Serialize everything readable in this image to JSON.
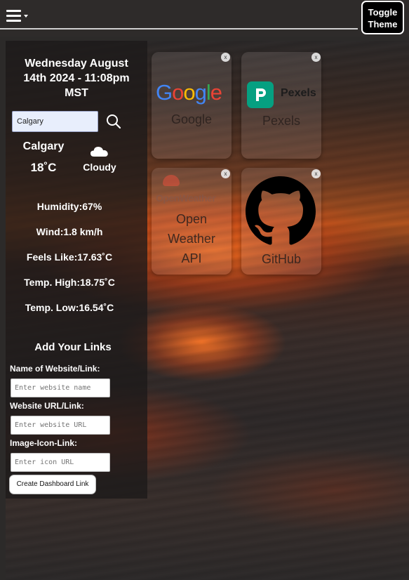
{
  "header": {
    "toggle_label_1": "Toggle",
    "toggle_label_2": "Theme",
    "menu_icon": "hamburger-icon"
  },
  "weather": {
    "date_line1": "Wednesday August",
    "date_line2": "14th 2024 - 11:08pm",
    "date_line3": "MST",
    "city_input_value": "Calgary",
    "city": "Calgary",
    "temperature": "18˚C",
    "condition": "Cloudy",
    "condition_icon": "cloud-icon",
    "humidity": "Humidity:67%",
    "wind": "Wind:1.8 km/h",
    "feels_like": "Feels Like:17.63˚C",
    "temp_high": "Temp. High:18.75˚C",
    "temp_low": "Temp. Low:16.54˚C"
  },
  "links_form": {
    "title": "Add Your Links",
    "name_label": "Name of Website/Link:",
    "name_placeholder": "Enter website name",
    "url_label": "Website URL/Link:",
    "url_placeholder": "Enter website URL",
    "icon_label": "Image-Icon-Link:",
    "icon_placeholder": "Enter icon URL",
    "submit_label": "Create Dashboard Link"
  },
  "cards": [
    {
      "label": "Google",
      "logo_text": "Google",
      "close": "x"
    },
    {
      "label": "Pexels",
      "logo_text": "Pexels",
      "close": "x"
    },
    {
      "label_1": "Open",
      "label_2": "Weather",
      "label_3": "API",
      "logo_text": "OpenWeather",
      "close": "x"
    },
    {
      "label": "GitHub",
      "logo_icon": "github-icon",
      "close": "x"
    }
  ],
  "colors": {
    "pexels_brand": "#05a081",
    "panel_bg": "#1c1a1a",
    "topbar_bg": "#2e2b2a"
  }
}
